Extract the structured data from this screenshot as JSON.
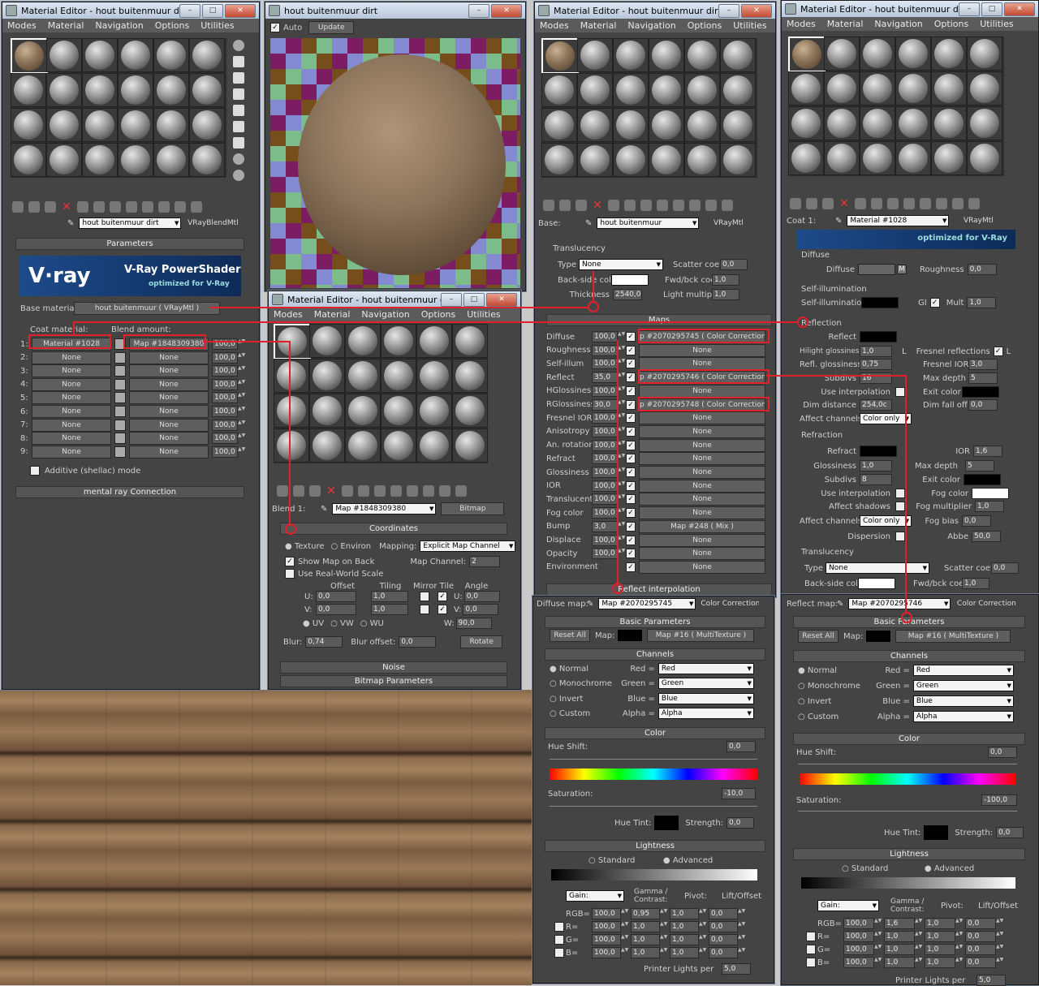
{
  "wood_bg": {
    "color": "#8a6a4c"
  },
  "win1": {
    "title": "Material Editor - hout buitenmuur dirt",
    "menu": [
      "Modes",
      "Material",
      "Navigation",
      "Options",
      "Utilities"
    ],
    "mat_name": "hout buitenmuur dirt",
    "mat_type": "VRayBlendMtl",
    "rollout_params": "Parameters",
    "vray_logo": "V·ray",
    "vray_title": "V-Ray PowerShader",
    "vray_sub": "optimized for V-Ray",
    "base_label": "Base material:",
    "base_value": "hout buitenmuur  ( VRayMtl )",
    "coat_label": "Coat material:",
    "blend_label": "Blend amount:",
    "rows": [
      {
        "n": "1:",
        "coat": "Material #1028",
        "blend": "Map #1848309380",
        "amt": "100,0"
      },
      {
        "n": "2:",
        "coat": "None",
        "blend": "None",
        "amt": "100,0"
      },
      {
        "n": "3:",
        "coat": "None",
        "blend": "None",
        "amt": "100,0"
      },
      {
        "n": "4:",
        "coat": "None",
        "blend": "None",
        "amt": "100,0"
      },
      {
        "n": "5:",
        "coat": "None",
        "blend": "None",
        "amt": "100,0"
      },
      {
        "n": "6:",
        "coat": "None",
        "blend": "None",
        "amt": "100,0"
      },
      {
        "n": "7:",
        "coat": "None",
        "blend": "None",
        "amt": "100,0"
      },
      {
        "n": "8:",
        "coat": "None",
        "blend": "None",
        "amt": "100,0"
      },
      {
        "n": "9:",
        "coat": "None",
        "blend": "None",
        "amt": "100,0"
      }
    ],
    "additive": "Additive (shellac) mode",
    "mental": "mental ray Connection"
  },
  "win2": {
    "title": "hout buitenmuur dirt",
    "auto": "Auto",
    "update": "Update"
  },
  "win3": {
    "title": "Material Editor - hout buitenmuur dirt",
    "menu": [
      "Modes",
      "Material",
      "Navigation",
      "Options",
      "Utilities"
    ],
    "blend_label": "Blend 1:",
    "map_name": "Map #1848309380",
    "map_type": "Bitmap",
    "coords": "Coordinates",
    "texture": "Texture",
    "environ": "Environ",
    "mapping_label": "Mapping:",
    "mapping_val": "Explicit Map Channel",
    "show_map": "Show Map on Back",
    "map_channel_label": "Map Channel:",
    "map_channel_val": "2",
    "real_world": "Use Real-World Scale",
    "col_offset": "Offset",
    "col_tiling": "Tiling",
    "col_mirror": "Mirror Tile",
    "col_angle": "Angle",
    "u_lbl": "U:",
    "v_lbl": "V:",
    "w_lbl": "W:",
    "u_off": "0,0",
    "v_off": "0,0",
    "u_til": "1,0",
    "v_til": "1,0",
    "u_ang": "0,0",
    "v_ang": "0,0",
    "w_ang": "90,0",
    "uv": "UV",
    "vw": "VW",
    "wu": "WU",
    "blur_lbl": "Blur:",
    "blur_val": "0,74",
    "blur_off_lbl": "Blur offset:",
    "blur_off_val": "0,0",
    "rotate": "Rotate",
    "noise": "Noise",
    "bitmap_params": "Bitmap Parameters"
  },
  "win4": {
    "title": "Material Editor - hout buitenmuur dirt",
    "menu": [
      "Modes",
      "Material",
      "Navigation",
      "Options",
      "Utilities"
    ],
    "base_label": "Base:",
    "mat_name": "hout buitenmuur",
    "mat_type": "VRayMtl",
    "translucency": "Translucency",
    "type_lbl": "Type",
    "type_val": "None",
    "scatter_lbl": "Scatter coeff",
    "scatter_val": "0,0",
    "backside_lbl": "Back-side color",
    "fwdbck_lbl": "Fwd/bck coeff",
    "fwdbck_val": "1,0",
    "thickness_lbl": "Thickness",
    "thickness_val": "2540,0",
    "lightmult_lbl": "Light multiplier",
    "lightmult_val": "1,0",
    "maps_hdr": "Maps",
    "maps": [
      {
        "name": "Diffuse",
        "val": "100,0",
        "map": "p #2070295745  ( Color Correction )"
      },
      {
        "name": "Roughness",
        "val": "100,0",
        "map": "None"
      },
      {
        "name": "Self-illum",
        "val": "100,0",
        "map": "None"
      },
      {
        "name": "Reflect",
        "val": "35,0",
        "map": "p #2070295746  ( Color Correction )"
      },
      {
        "name": "HGlossiness",
        "val": "100,0",
        "map": "None"
      },
      {
        "name": "RGlossiness",
        "val": "30,0",
        "map": "p #2070295748  ( Color Correction )"
      },
      {
        "name": "Fresnel IOR",
        "val": "100,0",
        "map": "None"
      },
      {
        "name": "Anisotropy",
        "val": "100,0",
        "map": "None"
      },
      {
        "name": "An. rotation",
        "val": "100,0",
        "map": "None"
      },
      {
        "name": "Refract",
        "val": "100,0",
        "map": "None"
      },
      {
        "name": "Glossiness",
        "val": "100,0",
        "map": "None"
      },
      {
        "name": "IOR",
        "val": "100,0",
        "map": "None"
      },
      {
        "name": "Translucent",
        "val": "100,0",
        "map": "None"
      },
      {
        "name": "Fog color",
        "val": "100,0",
        "map": "None"
      },
      {
        "name": "Bump",
        "val": "3,0",
        "map": "Map #248  ( Mix )"
      },
      {
        "name": "Displace",
        "val": "100,0",
        "map": "None"
      },
      {
        "name": "Opacity",
        "val": "100,0",
        "map": "None"
      },
      {
        "name": "Environment",
        "val": "",
        "map": "None"
      }
    ],
    "reflect_interp": "Reflect interpolation"
  },
  "cc1": {
    "label": "Diffuse map:",
    "map_name": "Map #2070295745",
    "map_type": "Color Correction",
    "basic": "Basic Parameters",
    "reset": "Reset All",
    "map_lbl": "Map:",
    "map_val": "Map #16  ( MultiTexture )",
    "channels": "Channels",
    "normal": "Normal",
    "mono": "Monochrome",
    "invert": "Invert",
    "custom": "Custom",
    "red_lbl": "Red =",
    "green_lbl": "Green =",
    "blue_lbl": "Blue =",
    "alpha_lbl": "Alpha =",
    "red": "Red",
    "green": "Green",
    "blue": "Blue",
    "alpha": "Alpha",
    "color_hdr": "Color",
    "hue_shift": "Hue Shift:",
    "hue_val": "0,0",
    "saturation": "Saturation:",
    "sat_val": "-10,0",
    "hue_tint": "Hue Tint:",
    "strength": "Strength:",
    "str_val": "0,0",
    "lightness": "Lightness",
    "standard": "Standard",
    "advanced": "Advanced",
    "gain": "Gain:",
    "gamma": "Gamma / Contrast:",
    "pivot": "Pivot:",
    "lift": "Lift/Offset",
    "rgb": "RGB=",
    "r": "R=",
    "g": "G=",
    "b": "B=",
    "rows": [
      [
        "100,0",
        "0,95",
        "1,0",
        "0,0"
      ],
      [
        "100,0",
        "1,0",
        "1,0",
        "0,0"
      ],
      [
        "100,0",
        "1,0",
        "1,0",
        "0,0"
      ],
      [
        "100,0",
        "1,0",
        "1,0",
        "0,0"
      ]
    ],
    "printer": "Printer Lights per",
    "printer_val": "5,0"
  },
  "win5": {
    "title": "Material Editor - hout buitenmuur dirt",
    "menu": [
      "Modes",
      "Material",
      "Navigation",
      "Options",
      "Utilities"
    ],
    "coat_label": "Coat 1:",
    "mat_name": "Material #1028",
    "mat_type": "VRayMtl",
    "logo_sub": "optimized for V-Ray",
    "diffuse_grp": "Diffuse",
    "diffuse_lbl": "Diffuse",
    "rough_lbl": "Roughness",
    "rough_val": "0,0",
    "selfillum_grp": "Self-illumination",
    "selfillum_lbl": "Self-illumination",
    "gi_lbl": "GI",
    "mult_lbl": "Mult",
    "mult_val": "1,0",
    "reflection_grp": "Reflection",
    "reflect_lbl": "Reflect",
    "hilight_lbl": "Hilight glossiness",
    "hilight_val": "1,0",
    "l_lbl": "L",
    "fresnel_lbl": "Fresnel reflections",
    "reflg_lbl": "Refl. glossiness",
    "reflg_val": "0,75",
    "fior_lbl": "Fresnel IOR",
    "fior_val": "3,0",
    "subdivs_lbl": "Subdivs",
    "subdivs_val": "16",
    "maxd_lbl": "Max depth",
    "maxd_val": "5",
    "useint_lbl": "Use interpolation",
    "exit_lbl": "Exit color",
    "dimd_lbl": "Dim distance",
    "dimd_val": "254,0c",
    "dimf_lbl": "Dim fall off",
    "dimf_val": "0,0",
    "affch_lbl": "Affect channels",
    "affch_val": "Color only",
    "refraction_grp": "Refraction",
    "refract_lbl": "Refract",
    "ior_lbl": "IOR",
    "ior_val": "1,6",
    "gloss_lbl": "Glossiness",
    "gloss_val": "1,0",
    "maxd2_lbl": "Max depth",
    "maxd2_val": "5",
    "subdivs2_lbl": "Subdivs",
    "subdivs2_val": "8",
    "exit2_lbl": "Exit color",
    "useint2_lbl": "Use interpolation",
    "fogc_lbl": "Fog color",
    "affsh_lbl": "Affect shadows",
    "fogm_lbl": "Fog multiplier",
    "fogm_val": "1,0",
    "affch2_lbl": "Affect channels",
    "affch2_val": "Color only",
    "fogb_lbl": "Fog bias",
    "fogb_val": "0,0",
    "disp_lbl": "Dispersion",
    "abbe_lbl": "Abbe",
    "abbe_val": "50,0",
    "trans_grp": "Translucency",
    "type_lbl": "Type",
    "type_val": "None",
    "scatter_lbl": "Scatter coeff",
    "scatter_val": "0,0",
    "backside_lbl": "Back-side color",
    "fwdbck_lbl": "Fwd/bck coeff",
    "fwdbck_val": "1,0"
  },
  "cc2": {
    "label": "Reflect map:",
    "map_name": "Map #2070295746",
    "map_type": "Color Correction",
    "basic": "Basic Parameters",
    "reset": "Reset All",
    "map_lbl": "Map:",
    "map_val": "Map #16  ( MultiTexture )",
    "channels": "Channels",
    "normal": "Normal",
    "mono": "Monochrome",
    "invert": "Invert",
    "custom": "Custom",
    "red_lbl": "Red =",
    "green_lbl": "Green =",
    "blue_lbl": "Blue =",
    "alpha_lbl": "Alpha =",
    "red": "Red",
    "green": "Green",
    "blue": "Blue",
    "alpha": "Alpha",
    "color_hdr": "Color",
    "hue_shift": "Hue Shift:",
    "hue_val": "0,0",
    "saturation": "Saturation:",
    "sat_val": "-100,0",
    "hue_tint": "Hue Tint:",
    "strength": "Strength:",
    "str_val": "0,0",
    "lightness": "Lightness",
    "standard": "Standard",
    "advanced": "Advanced",
    "gain": "Gain:",
    "gamma": "Gamma / Contrast:",
    "pivot": "Pivot:",
    "lift": "Lift/Offset",
    "rgb": "RGB=",
    "r": "R=",
    "g": "G=",
    "b": "B=",
    "rows": [
      [
        "100,0",
        "1,6",
        "1,0",
        "0,0"
      ],
      [
        "100,0",
        "1,0",
        "1,0",
        "0,0"
      ],
      [
        "100,0",
        "1,0",
        "1,0",
        "0,0"
      ],
      [
        "100,0",
        "1,0",
        "1,0",
        "0,0"
      ]
    ],
    "printer": "Printer Lights per",
    "printer_val": "5,0"
  }
}
